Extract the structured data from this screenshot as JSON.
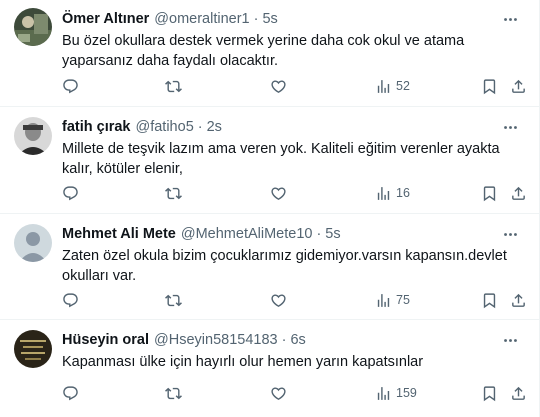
{
  "tweets": [
    {
      "name": "Ömer Altıner",
      "handle": "@omeraltiner1",
      "time": "5s",
      "text": "Bu özel okullara destek vermek yerine daha cok okul ve atama yaparsanız daha faydalı olacaktır.",
      "views": "52",
      "avatar": "photo-avatar"
    },
    {
      "name": "fatih çırak",
      "handle": "@fatiho5",
      "time": "2s",
      "text": "Millete de teşvik lazım ama veren yok. Kaliteli eğitim verenler ayakta kalır, kötüler elenir,",
      "views": "16",
      "avatar": "photo-avatar"
    },
    {
      "name": "Mehmet Ali Mete",
      "handle": "@MehmetAliMete10",
      "time": "5s",
      "text": "Zaten özel okula bizim çocuklarımız gidemiyor.varsın kapansın.devlet okulları var.",
      "views": "75",
      "avatar": "default-avatar"
    },
    {
      "name": "Hüseyin oral",
      "handle": "@Hseyin58154183",
      "time": "6s",
      "text": "Kapanması ülke için hayırlı olur hemen yarın kapatsınlar",
      "views": "159",
      "avatar": "photo-avatar"
    }
  ],
  "separator": "·",
  "icons": {
    "reply": "reply-icon",
    "retweet": "retweet-icon",
    "like": "like-icon",
    "views": "views-icon",
    "bookmark": "bookmark-icon",
    "share": "share-icon",
    "more": "more-icon"
  },
  "colors": {
    "text": "#0f1419",
    "secondary": "#536471",
    "divider": "#eff3f4"
  }
}
